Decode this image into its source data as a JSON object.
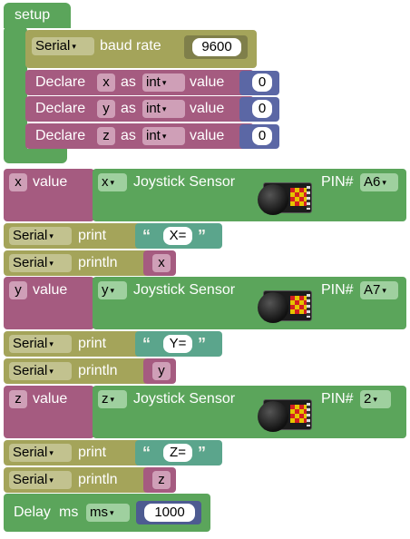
{
  "setup": {
    "label": "setup",
    "serial": {
      "dropdown": "Serial",
      "baud_label": "baud rate",
      "baud_value": "9600"
    },
    "declares": [
      {
        "label": "Declare",
        "var": "x",
        "as": "as",
        "type": "int",
        "value_label": "value",
        "value": "0"
      },
      {
        "label": "Declare",
        "var": "y",
        "as": "as",
        "type": "int",
        "value_label": "value",
        "value": "0"
      },
      {
        "label": "Declare",
        "var": "z",
        "as": "as",
        "type": "int",
        "value_label": "value",
        "value": "0"
      }
    ]
  },
  "sensors": [
    {
      "var": "x",
      "value_label": "value",
      "axis": "x",
      "sensor_label": "Joystick Sensor",
      "pin_label": "PIN#",
      "pin": "A6",
      "print": {
        "dropdown": "Serial",
        "label": "print",
        "text": "X="
      },
      "println": {
        "dropdown": "Serial",
        "label": "println",
        "var": "x"
      }
    },
    {
      "var": "y",
      "value_label": "value",
      "axis": "y",
      "sensor_label": "Joystick Sensor",
      "pin_label": "PIN#",
      "pin": "A7",
      "print": {
        "dropdown": "Serial",
        "label": "print",
        "text": "Y="
      },
      "println": {
        "dropdown": "Serial",
        "label": "println",
        "var": "y"
      }
    },
    {
      "var": "z",
      "value_label": "value",
      "axis": "z",
      "sensor_label": "Joystick Sensor",
      "pin_label": "PIN#",
      "pin": "2",
      "print": {
        "dropdown": "Serial",
        "label": "print",
        "text": "Z="
      },
      "println": {
        "dropdown": "Serial",
        "label": "println",
        "var": "z"
      }
    }
  ],
  "delay": {
    "label": "Delay",
    "unit": "ms",
    "value": "1000"
  },
  "glyphs": {
    "dropdown_arrow": "▾",
    "open_quote": "“",
    "close_quote": "”"
  },
  "colors": {
    "control": "#5ba55b",
    "serial": "#a4a45a",
    "variable": "#a55b80",
    "math": "#5b67a5",
    "text": "#5ba58c"
  }
}
